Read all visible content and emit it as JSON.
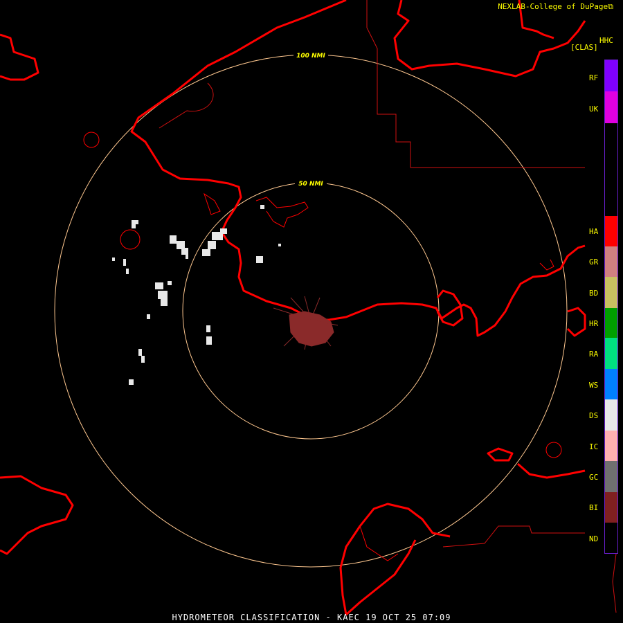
{
  "credit": "NEXLAB-College of DuPage",
  "credit_icon": "external-link-icon",
  "product": {
    "code": "HHC",
    "mode": "[CLAS]"
  },
  "footer": "HYDROMETEOR CLASSIFICATION - KAEC 19 OCT 25 07:09",
  "range_rings": [
    {
      "label": "50 NMI"
    },
    {
      "label": "100 NMI"
    }
  ],
  "legend": [
    {
      "code": "RF",
      "color": "#8000ff"
    },
    {
      "code": "UK",
      "color": "#e000e0"
    },
    {
      "code": "HA",
      "color": "#ff0000"
    },
    {
      "code": "GR",
      "color": "#d08080"
    },
    {
      "code": "BD",
      "color": "#c8c060"
    },
    {
      "code": "HR",
      "color": "#00a000"
    },
    {
      "code": "RA",
      "color": "#00e080"
    },
    {
      "code": "WS",
      "color": "#0080ff"
    },
    {
      "code": "DS",
      "color": "#e8e8e8"
    },
    {
      "code": "IC",
      "color": "#ffb0b0"
    },
    {
      "code": "GC",
      "color": "#707070"
    },
    {
      "code": "BI",
      "color": "#802020"
    },
    {
      "code": "ND",
      "color": "#000000"
    }
  ],
  "colors": {
    "coastline": "#ff0000",
    "border": "#d01010",
    "ring": "#ffc890",
    "text": "#ffff00",
    "background": "#000000"
  }
}
